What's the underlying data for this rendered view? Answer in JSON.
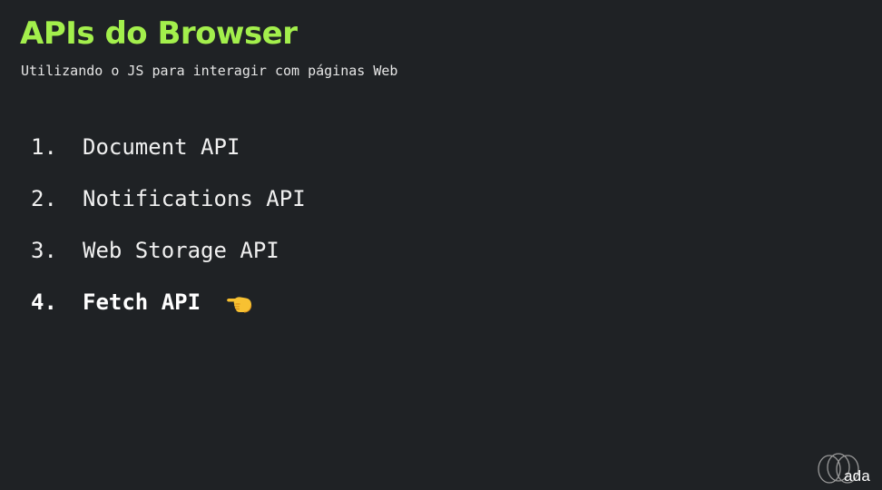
{
  "slide": {
    "title": "APIs do Browser",
    "subtitle": "Utilizando o JS para interagir com páginas Web",
    "items": [
      {
        "number": "1.",
        "label": "Document API"
      },
      {
        "number": "2.",
        "label": "Notifications API"
      },
      {
        "number": "3.",
        "label": "Web Storage API"
      },
      {
        "number": "4.",
        "label": "Fetch API"
      }
    ],
    "active_item": 4,
    "pointer_icon": "backhand-index-pointing-left-icon",
    "logo_text": "ada"
  },
  "colors": {
    "background": "#1f2225",
    "title": "#a3ef4c",
    "text": "#f0f0f0"
  }
}
